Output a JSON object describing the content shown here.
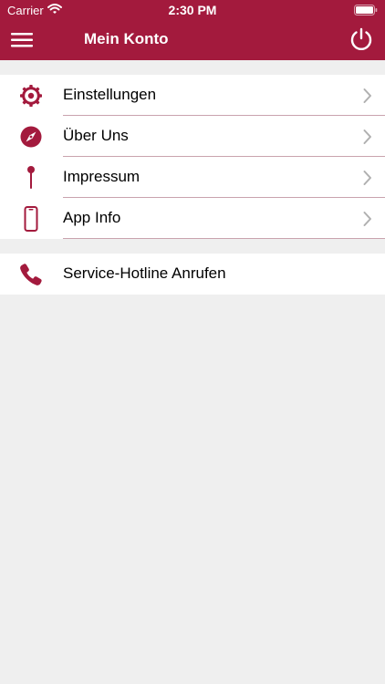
{
  "status_bar": {
    "carrier": "Carrier",
    "time": "2:30 PM"
  },
  "header": {
    "title": "Mein Konto"
  },
  "menu": {
    "items": [
      {
        "label": "Einstellungen",
        "icon": "gear-icon"
      },
      {
        "label": "Über Uns",
        "icon": "compass-icon"
      },
      {
        "label": "Impressum",
        "icon": "pin-icon"
      },
      {
        "label": "App Info",
        "icon": "smartphone-icon"
      }
    ]
  },
  "hotline": {
    "label": "Service-Hotline Anrufen",
    "icon": "phone-icon"
  },
  "colors": {
    "brand": "#a31a3d",
    "background": "#efefef",
    "separator": "#c9a3ae",
    "chevron": "#b0b0b0"
  }
}
